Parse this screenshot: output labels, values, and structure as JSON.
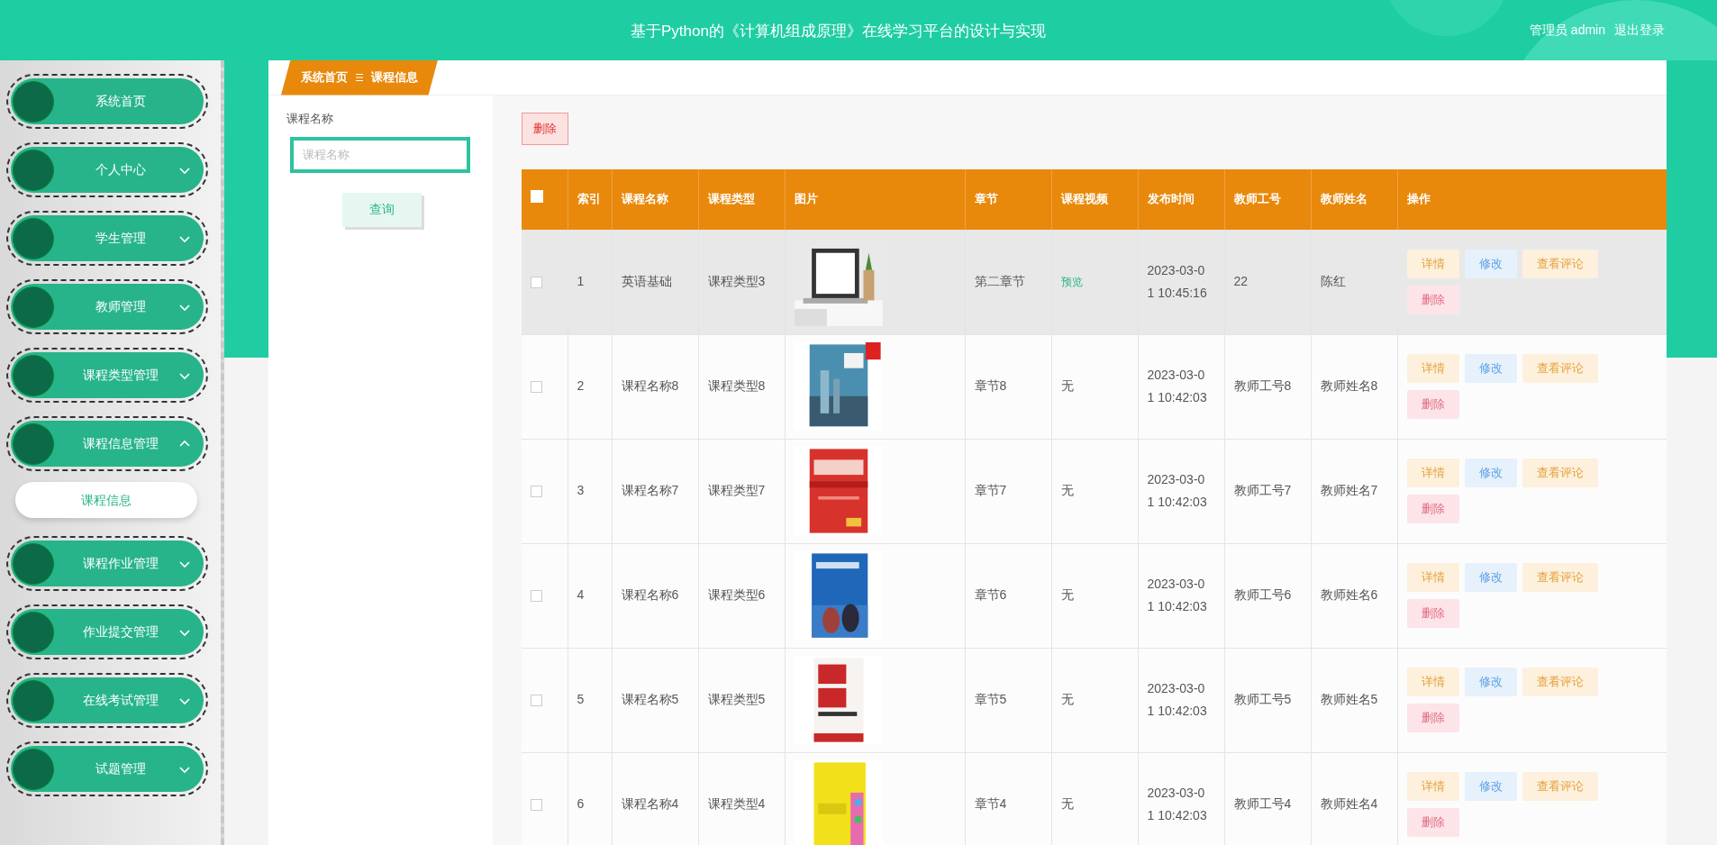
{
  "header": {
    "title": "基于Python的《计算机组成原理》在线学习平台的设计与实现",
    "user": "管理员 admin",
    "logout": "退出登录"
  },
  "sidebar": {
    "items": [
      {
        "label": "系统首页",
        "expandable": false,
        "expanded": false
      },
      {
        "label": "个人中心",
        "expandable": true,
        "expanded": false
      },
      {
        "label": "学生管理",
        "expandable": true,
        "expanded": false
      },
      {
        "label": "教师管理",
        "expandable": true,
        "expanded": false
      },
      {
        "label": "课程类型管理",
        "expandable": true,
        "expanded": false
      },
      {
        "label": "课程信息管理",
        "expandable": true,
        "expanded": true,
        "children": [
          {
            "label": "课程信息",
            "selected": true
          }
        ]
      },
      {
        "label": "课程作业管理",
        "expandable": true,
        "expanded": false
      },
      {
        "label": "作业提交管理",
        "expandable": true,
        "expanded": false
      },
      {
        "label": "在线考试管理",
        "expandable": true,
        "expanded": false
      },
      {
        "label": "试题管理",
        "expandable": true,
        "expanded": false
      }
    ]
  },
  "breadcrumb": [
    "系统首页",
    "课程信息"
  ],
  "search": {
    "label": "课程名称",
    "placeholder": "课程名称",
    "button": "查询"
  },
  "toolbar": {
    "delete_button": "删除"
  },
  "table": {
    "select_all_checked": false,
    "columns": [
      "索引",
      "课程名称",
      "课程类型",
      "图片",
      "章节",
      "课程视频",
      "发布时间",
      "教师工号",
      "教师姓名",
      "操作"
    ],
    "rows": [
      {
        "checked": false,
        "highlighted": true,
        "index": "1",
        "name": "英语基础",
        "type": "课程类型3",
        "chapter": "第二章节",
        "video": {
          "text": "预览",
          "kind": "link"
        },
        "time": "2023-03-01 10:45:16",
        "teacher_id": "22",
        "teacher_name": "陈红",
        "actions": [
          {
            "label": "详情",
            "kind": "detail"
          },
          {
            "label": "修改",
            "kind": "edit"
          },
          {
            "label": "查看评论",
            "kind": "comment"
          },
          {
            "label": "删除",
            "kind": "delete"
          }
        ]
      },
      {
        "checked": false,
        "highlighted": false,
        "index": "2",
        "name": "课程名称8",
        "type": "课程类型8",
        "chapter": "章节8",
        "video": {
          "text": "无",
          "kind": "text"
        },
        "time": "2023-03-01 10:42:03",
        "teacher_id": "教师工号8",
        "teacher_name": "教师姓名8",
        "actions": [
          {
            "label": "详情",
            "kind": "detail"
          },
          {
            "label": "修改",
            "kind": "edit"
          },
          {
            "label": "查看评论",
            "kind": "comment"
          },
          {
            "label": "删除",
            "kind": "delete"
          }
        ]
      },
      {
        "checked": false,
        "highlighted": false,
        "index": "3",
        "name": "课程名称7",
        "type": "课程类型7",
        "chapter": "章节7",
        "video": {
          "text": "无",
          "kind": "text"
        },
        "time": "2023-03-01 10:42:03",
        "teacher_id": "教师工号7",
        "teacher_name": "教师姓名7",
        "actions": [
          {
            "label": "详情",
            "kind": "detail"
          },
          {
            "label": "修改",
            "kind": "edit"
          },
          {
            "label": "查看评论",
            "kind": "comment"
          },
          {
            "label": "删除",
            "kind": "delete"
          }
        ]
      },
      {
        "checked": false,
        "highlighted": false,
        "index": "4",
        "name": "课程名称6",
        "type": "课程类型6",
        "chapter": "章节6",
        "video": {
          "text": "无",
          "kind": "text"
        },
        "time": "2023-03-01 10:42:03",
        "teacher_id": "教师工号6",
        "teacher_name": "教师姓名6",
        "actions": [
          {
            "label": "详情",
            "kind": "detail"
          },
          {
            "label": "修改",
            "kind": "edit"
          },
          {
            "label": "查看评论",
            "kind": "comment"
          },
          {
            "label": "删除",
            "kind": "delete"
          }
        ]
      },
      {
        "checked": false,
        "highlighted": false,
        "index": "5",
        "name": "课程名称5",
        "type": "课程类型5",
        "chapter": "章节5",
        "video": {
          "text": "无",
          "kind": "text"
        },
        "time": "2023-03-01 10:42:03",
        "teacher_id": "教师工号5",
        "teacher_name": "教师姓名5",
        "actions": [
          {
            "label": "详情",
            "kind": "detail"
          },
          {
            "label": "修改",
            "kind": "edit"
          },
          {
            "label": "查看评论",
            "kind": "comment"
          },
          {
            "label": "删除",
            "kind": "delete"
          }
        ]
      },
      {
        "checked": false,
        "highlighted": false,
        "index": "6",
        "name": "课程名称4",
        "type": "课程类型4",
        "chapter": "章节4",
        "video": {
          "text": "无",
          "kind": "text"
        },
        "time": "2023-03-01 10:42:03",
        "teacher_id": "教师工号4",
        "teacher_name": "教师姓名4",
        "actions": [
          {
            "label": "详情",
            "kind": "detail"
          },
          {
            "label": "修改",
            "kind": "edit"
          },
          {
            "label": "查看评论",
            "kind": "comment"
          },
          {
            "label": "删除",
            "kind": "delete"
          }
        ]
      }
    ]
  }
}
